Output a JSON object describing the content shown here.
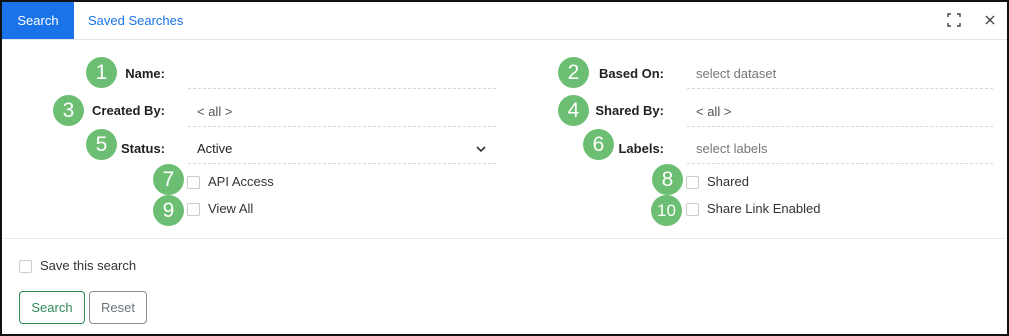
{
  "tabs": {
    "search": "Search",
    "saved": "Saved Searches"
  },
  "icons": {
    "expand": "expand-icon",
    "close": "close-icon",
    "chevron": "chevron-down-icon"
  },
  "badges": [
    "1",
    "2",
    "3",
    "4",
    "5",
    "6",
    "7",
    "8",
    "9",
    "10"
  ],
  "form": {
    "name": {
      "label": "Name:",
      "value": ""
    },
    "based_on": {
      "label": "Based On:",
      "placeholder": "select dataset"
    },
    "created_by": {
      "label": "Created By:",
      "value": "< all >"
    },
    "shared_by": {
      "label": "Shared By:",
      "value": "< all >"
    },
    "status": {
      "label": "Status:",
      "value": "Active"
    },
    "labels": {
      "label": "Labels:",
      "placeholder": "select labels"
    },
    "api_access": {
      "label": "API Access",
      "checked": false
    },
    "view_all": {
      "label": "View All",
      "checked": false
    },
    "shared": {
      "label": "Shared",
      "checked": false
    },
    "share_link": {
      "label": "Share Link Enabled",
      "checked": false
    }
  },
  "footer": {
    "save_search": {
      "label": "Save this search",
      "checked": false
    },
    "search_button": "Search",
    "reset_button": "Reset"
  },
  "colors": {
    "accent": "#1a73e8",
    "badge": "#6cbf72",
    "search_button": "#2e8b57"
  }
}
